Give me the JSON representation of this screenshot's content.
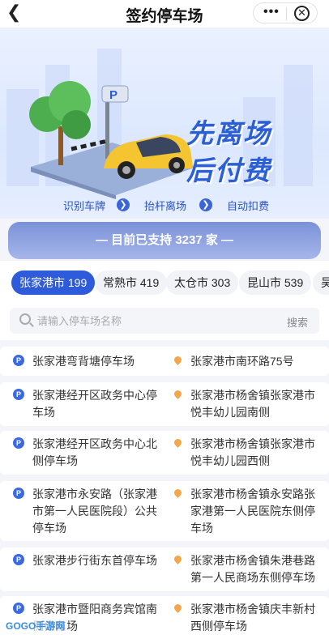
{
  "header": {
    "title": "签约停车场",
    "back_icon": "chevron-left-icon",
    "more_icon": "more-dots-icon",
    "close_icon": "close-circle-icon"
  },
  "banner": {
    "slogan_line1": "先离场",
    "slogan_line2": "后付费",
    "sign_text": "P",
    "steps": [
      "识别车牌",
      "抬杆离场",
      "自动扣费"
    ],
    "colors": {
      "accent": "#2e5bd9",
      "car": "#f5c531",
      "tree": "#4cae4f"
    }
  },
  "support": {
    "prefix": "— 目前已支持",
    "count": "3237",
    "suffix": "家 —"
  },
  "tabs": [
    {
      "label": "张家港市 199",
      "active": true
    },
    {
      "label": "常熟市 419",
      "active": false
    },
    {
      "label": "太仓市 303",
      "active": false
    },
    {
      "label": "昆山市 539",
      "active": false
    },
    {
      "label": "吴",
      "active": false
    }
  ],
  "search": {
    "placeholder": "请输入停车场名称",
    "button": "搜索"
  },
  "parking_list": [
    {
      "name": "张家港弯背塘停车场",
      "address": "张家港市南环路75号"
    },
    {
      "name": "张家港经开区政务中心停车场",
      "address": "张家港市杨舍镇张家港市悦丰幼儿园南侧"
    },
    {
      "name": "张家港经开区政务中心北侧停车场",
      "address": "张家港市杨舍镇张家港市悦丰幼儿园西侧"
    },
    {
      "name": "张家港市永安路（张家港市第一人民医院段）公共停车场",
      "address": "张家港市杨舍镇永安路张家港第一人民医院东侧停车场"
    },
    {
      "name": "张家港步行街东首停车场",
      "address": "张家港市杨舍镇朱港巷路第一人民商场东侧停车场"
    },
    {
      "name": "张家港市暨阳商务宾馆南侧停车场",
      "address": "张家港市杨舍镇庆丰新村西侧停车场"
    }
  ],
  "watermark": "GOGO手游网"
}
